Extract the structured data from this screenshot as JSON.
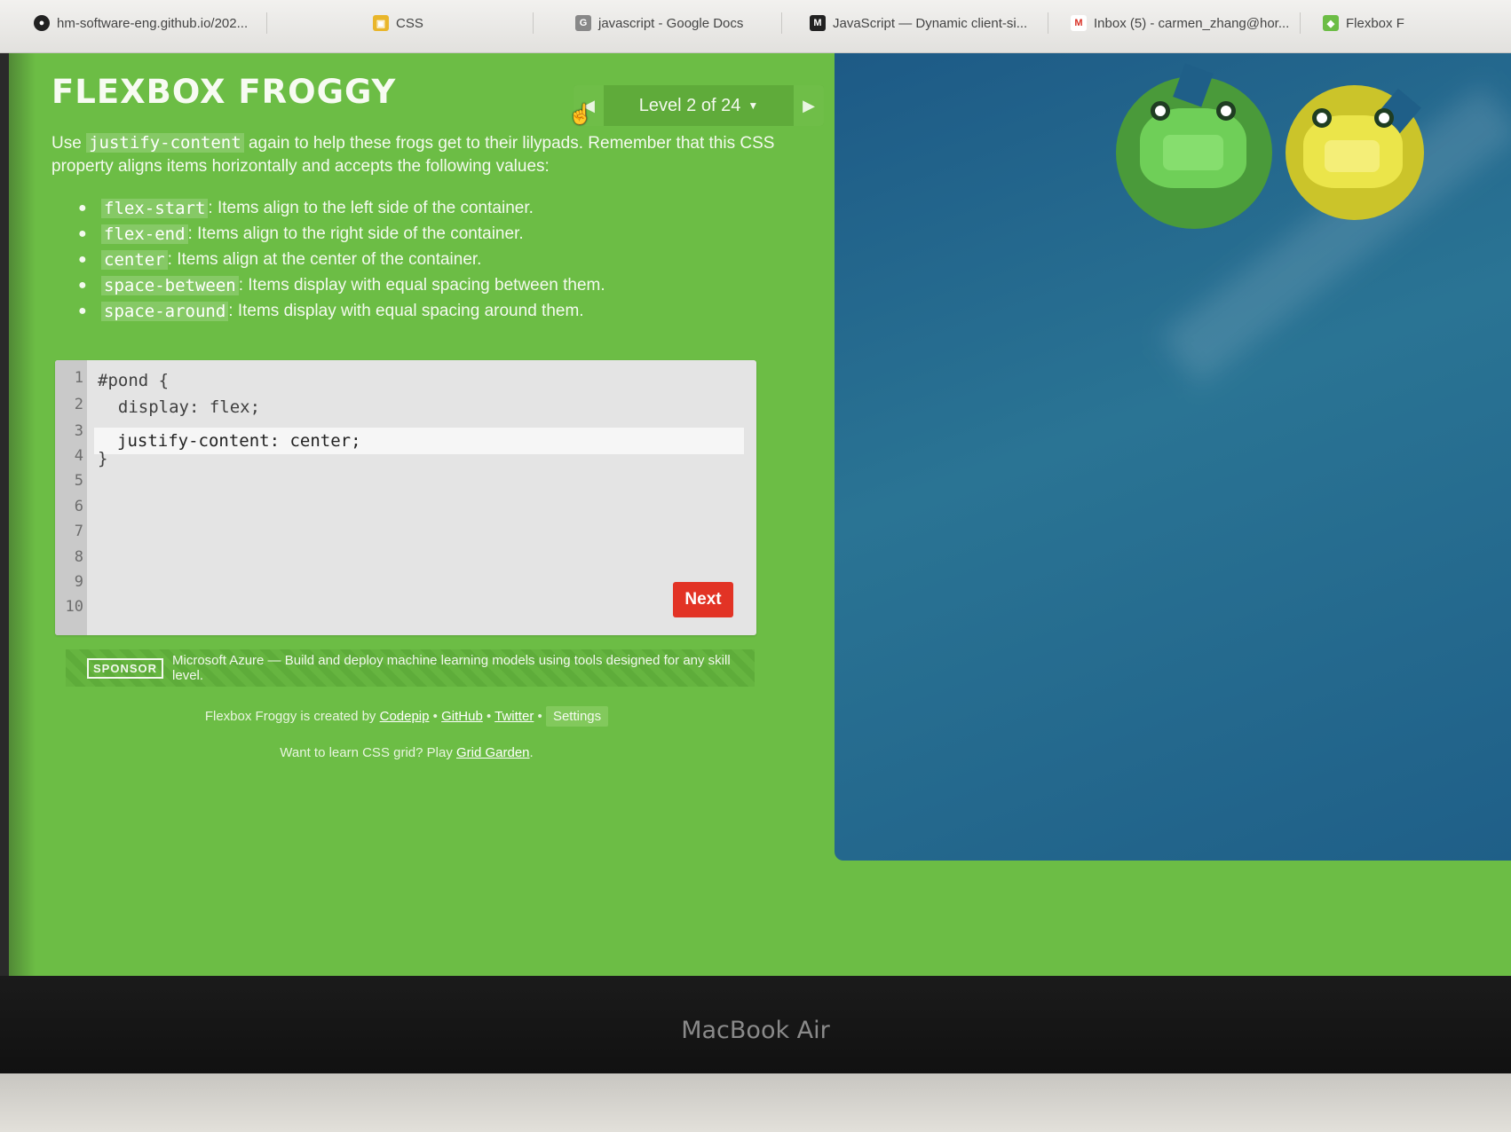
{
  "browser": {
    "tabs": [
      {
        "label": "hm-software-eng.github.io/202...",
        "icon": "github-icon"
      },
      {
        "label": "CSS",
        "icon": "slides-icon"
      },
      {
        "label": "javascript - Google Docs",
        "icon": "google-docs-icon"
      },
      {
        "label": "JavaScript — Dynamic client-si...",
        "icon": "mdn-icon"
      },
      {
        "label": "Inbox (5) - carmen_zhang@hor...",
        "icon": "gmail-icon"
      },
      {
        "label": "Flexbox F",
        "icon": "frog-icon"
      }
    ]
  },
  "game": {
    "title": "FLEXBOX FROGGY",
    "level": {
      "label": "Level 2 of 24",
      "current": 2,
      "total": 24
    },
    "instructions": {
      "use": "Use",
      "property": "justify-content",
      "rest": "again to help these frogs get to their lilypads. Remember that this CSS property aligns items horizontally and accepts the following values:"
    },
    "values": [
      {
        "name": "flex-start",
        "desc": ": Items align to the left side of the container."
      },
      {
        "name": "flex-end",
        "desc": ": Items align to the right side of the container."
      },
      {
        "name": "center",
        "desc": ": Items align at the center of the container."
      },
      {
        "name": "space-between",
        "desc": ": Items display with equal spacing between them."
      },
      {
        "name": "space-around",
        "desc": ": Items display with equal spacing around them."
      }
    ],
    "editor": {
      "line_numbers": [
        "1",
        "2",
        "3",
        "4",
        "5",
        "6",
        "7",
        "8",
        "9",
        "10"
      ],
      "line1": "#pond {",
      "line2": "  display: flex;",
      "input_value": "justify-content: center;",
      "line4": "}"
    },
    "next_label": "Next",
    "sponsor": {
      "badge": "SPONSOR",
      "text": "Microsoft Azure — Build and deploy machine learning models using tools designed for any skill level."
    },
    "credits": {
      "prefix": "Flexbox Froggy is created by",
      "codepip": "Codepip",
      "github": "GitHub",
      "twitter": "Twitter",
      "sep": "•",
      "settings": "Settings"
    },
    "gridgarden": {
      "prefix": "Want to learn CSS grid? Play",
      "link": "Grid Garden",
      "suffix": "."
    }
  },
  "device": {
    "label": "MacBook Air"
  },
  "colors": {
    "game_bg": "#6cbd45",
    "pond": "#1f5f88",
    "next_button": "#e23325",
    "frog_green": "#6fcf58",
    "frog_yellow": "#ebe54a"
  }
}
